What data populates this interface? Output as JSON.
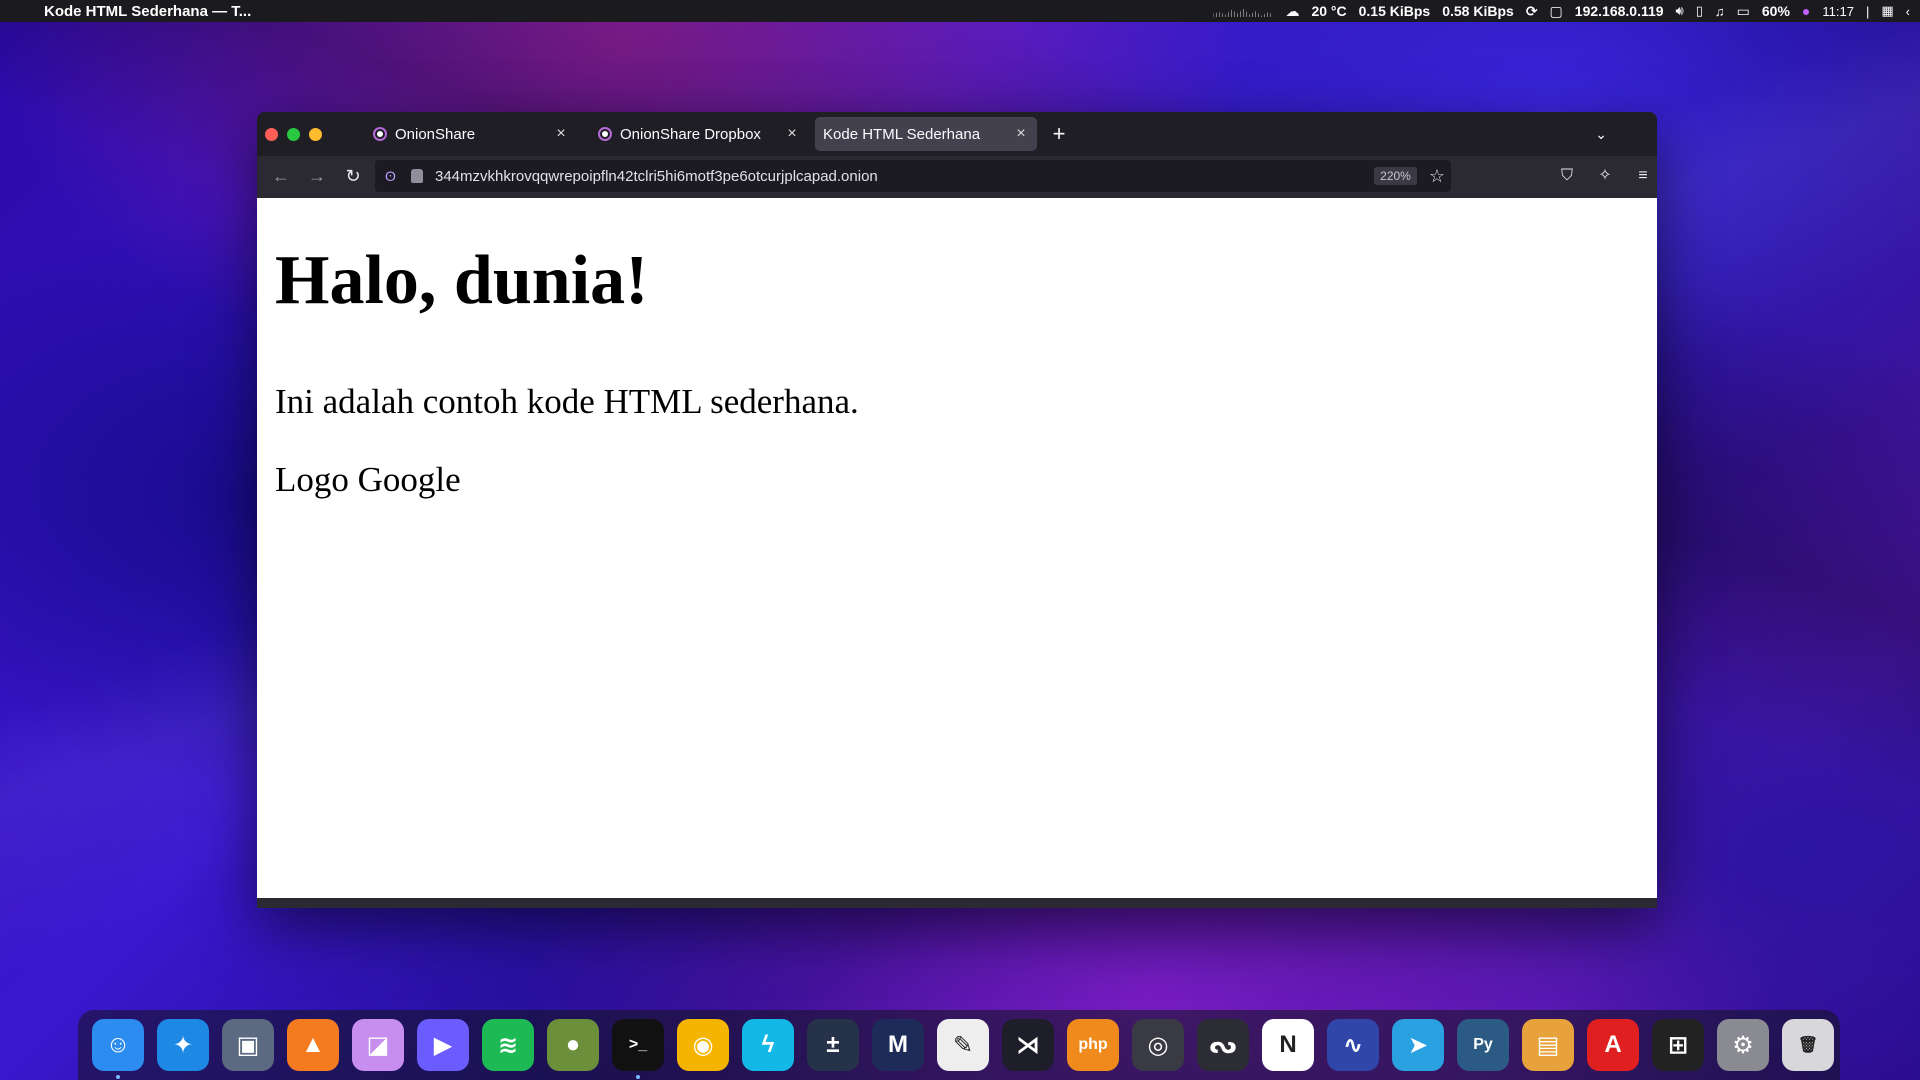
{
  "menubar": {
    "app_title": "Kode HTML Sederhana — T...",
    "weather": "20 °C",
    "net_down": "0.15 KiBps",
    "net_up": "0.58 KiBps",
    "ip": "192.168.0.119",
    "battery": "60%",
    "time": "11:17"
  },
  "browser": {
    "tabs": [
      {
        "label": "OnionShare"
      },
      {
        "label": "OnionShare Dropbox"
      },
      {
        "label": "Kode HTML Sederhana"
      }
    ],
    "url": "344mzvkhkrovqqwrepoipfln42tclri5hi6motf3pe6otcurjplcapad.onion",
    "zoom": "220%"
  },
  "page": {
    "heading": "Halo, dunia!",
    "paragraph": "Ini adalah contoh kode HTML sederhana.",
    "image_alt": "Logo Google"
  },
  "dock": {
    "apps": [
      {
        "name": "Finder",
        "icon": "finder-icon",
        "color": "#2d8cf0"
      },
      {
        "name": "Safari",
        "icon": "safari-icon",
        "color": "#1e88e5"
      },
      {
        "name": "Screenshot",
        "icon": "screenshot-icon",
        "color": "#5b6a80"
      },
      {
        "name": "VLC",
        "icon": "vlc-icon",
        "color": "#f47b20"
      },
      {
        "name": "Preview",
        "icon": "preview-icon",
        "color": "#c78ef0"
      },
      {
        "name": "Video Player",
        "icon": "play-icon",
        "color": "#6b5cff"
      },
      {
        "name": "Spotify",
        "icon": "spotify-icon",
        "color": "#1db954"
      },
      {
        "name": "Kiwi",
        "icon": "kiwi-icon",
        "color": "#6b8f3a"
      },
      {
        "name": "Terminal",
        "icon": "terminal-icon",
        "color": "#111111"
      },
      {
        "name": "Podcasts",
        "icon": "podcast-icon",
        "color": "#f5b400"
      },
      {
        "name": "Electron",
        "icon": "bolt-icon",
        "color": "#14b8e6"
      },
      {
        "name": "Calculator",
        "icon": "calculator-icon",
        "color": "#26324a"
      },
      {
        "name": "Malwarebytes",
        "icon": "shield-m-icon",
        "color": "#1e2b58"
      },
      {
        "name": "TextEdit",
        "icon": "textedit-icon",
        "color": "#eeeeee"
      },
      {
        "name": "VS Code",
        "icon": "vscode-icon",
        "color": "#1e1e2a"
      },
      {
        "name": "PHP",
        "icon": "php-icon",
        "color": "#f08a1c"
      },
      {
        "name": "Screen Capture",
        "icon": "camera-icon",
        "color": "#3a3a44"
      },
      {
        "name": "Inkscape",
        "icon": "inkscape-icon",
        "color": "#2c2c34"
      },
      {
        "name": "Notion",
        "icon": "notion-icon",
        "color": "#ffffff"
      },
      {
        "name": "Waveform",
        "icon": "waveform-icon",
        "color": "#3046a8"
      },
      {
        "name": "Telegram",
        "icon": "telegram-icon",
        "color": "#2aa1e0"
      },
      {
        "name": "Python",
        "icon": "python-icon",
        "color": "#2b5b84"
      },
      {
        "name": "Archive",
        "icon": "archive-icon",
        "color": "#e8a23c"
      },
      {
        "name": "Acrobat",
        "icon": "pdf-icon",
        "color": "#e02020"
      },
      {
        "name": "Window Manager",
        "icon": "grid-icon",
        "color": "#222222"
      },
      {
        "name": "System Preferences",
        "icon": "gear-icon",
        "color": "#8a8a92"
      },
      {
        "name": "Trash",
        "icon": "trash-icon",
        "color": "#d8d8dc"
      }
    ]
  }
}
